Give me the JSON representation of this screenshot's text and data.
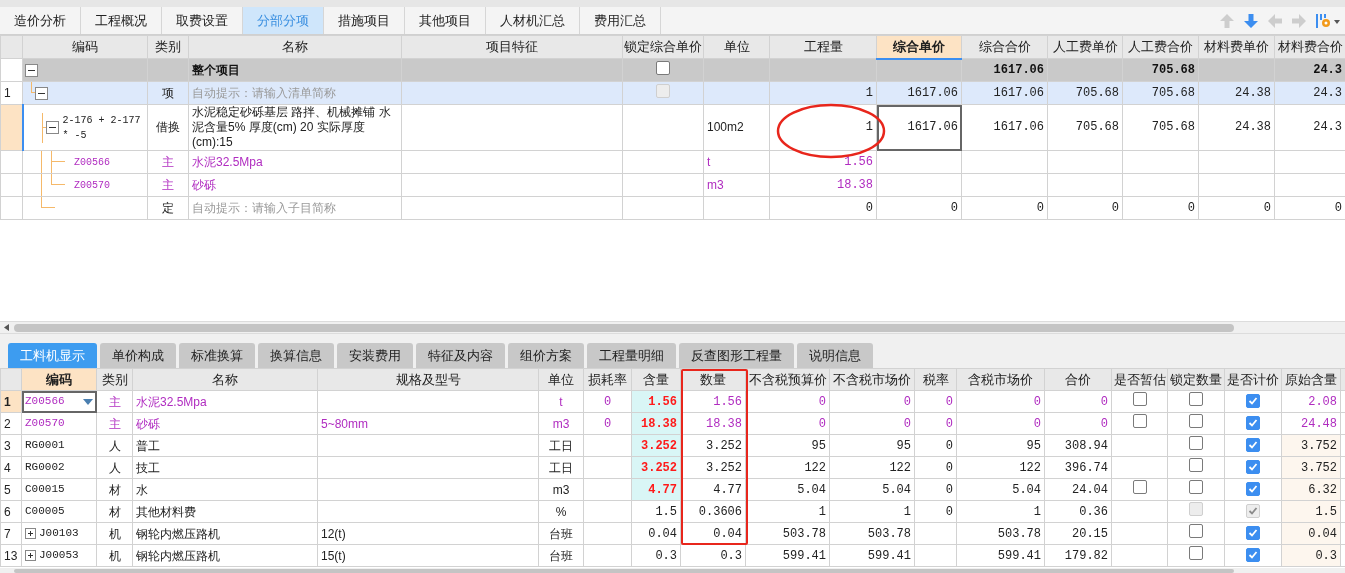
{
  "top_tabs": [
    {
      "label": "造价分析",
      "selected": false
    },
    {
      "label": "工程概况",
      "selected": false
    },
    {
      "label": "取费设置",
      "selected": false
    },
    {
      "label": "分部分项",
      "selected": true
    },
    {
      "label": "措施项目",
      "selected": false
    },
    {
      "label": "其他项目",
      "selected": false
    },
    {
      "label": "人材机汇总",
      "selected": false
    },
    {
      "label": "费用汇总",
      "selected": false
    }
  ],
  "toolbar": [
    {
      "kind": "up",
      "disabled": true
    },
    {
      "kind": "down",
      "disabled": false
    },
    {
      "kind": "left",
      "disabled": true
    },
    {
      "kind": "right",
      "disabled": true
    },
    {
      "kind": "settings",
      "disabled": false
    }
  ],
  "upper_table": {
    "columns": [
      {
        "label": "编码",
        "selected": false
      },
      {
        "label": "类别",
        "selected": false
      },
      {
        "label": "名称",
        "selected": false
      },
      {
        "label": "项目特征",
        "selected": false
      },
      {
        "label": "锁定综合单价",
        "selected": false
      },
      {
        "label": "单位",
        "selected": false
      },
      {
        "label": "工程量",
        "selected": false
      },
      {
        "label": "综合单价",
        "selected": true
      },
      {
        "label": "综合合价",
        "selected": false
      },
      {
        "label": "人工费单价",
        "selected": false
      },
      {
        "label": "人工费合价",
        "selected": false
      },
      {
        "label": "材料费单价",
        "selected": false
      },
      {
        "label": "材料费合价",
        "selected": false
      }
    ],
    "rows": [
      {
        "kind": "total",
        "selected": false,
        "expanded": true,
        "cells": [
          "",
          "",
          "整个项目",
          "",
          {
            "checked": false,
            "disabled": false
          },
          "",
          "",
          "",
          "1617.06",
          "",
          "705.68",
          "",
          "24.3"
        ],
        "children": [
          {
            "kind": "list",
            "selected": false,
            "number": "1",
            "expanded": true,
            "cells": [
              "",
              "项",
              {
                "placeholder": "自动提示：请输入清单简称"
              },
              "",
              {
                "checked": false,
                "disabled": true
              },
              "",
              "1",
              "1617.06",
              "1617.06",
              "705.68",
              "705.68",
              "24.38",
              "24.3"
            ],
            "children": [
              {
                "kind": "plain",
                "selected": true,
                "expanded": true,
                "cells": [
                  "2-176 + 2-177 * -5",
                  "借换",
                  "水泥稳定砂砾基层 路拌、机械摊铺 水泥含量5% 厚度(cm) 20  实际厚度(cm):15",
                  "",
                  "",
                  "100m2",
                  "1",
                  {
                    "text": "1617.06",
                    "focused": true
                  },
                  "1617.06",
                  "705.68",
                  "705.68",
                  "24.38",
                  "24.3"
                ],
                "children": [
                  {
                    "kind": "material",
                    "selected": false,
                    "cells": [
                      "Z00566",
                      "主",
                      "水泥32.5Mpa",
                      "",
                      "",
                      "t",
                      "1.56",
                      "",
                      "",
                      "",
                      "",
                      "",
                      ""
                    ]
                  },
                  {
                    "kind": "material",
                    "selected": false,
                    "cells": [
                      "Z00570",
                      "主",
                      "砂砾",
                      "",
                      "",
                      "m3",
                      "18.38",
                      "",
                      "",
                      "",
                      "",
                      "",
                      ""
                    ]
                  }
                ]
              },
              {
                "kind": "plain",
                "selected": false,
                "cells": [
                  "",
                  "定",
                  {
                    "placeholder": "自动提示：请输入子目简称"
                  },
                  "",
                  "",
                  "",
                  "0",
                  "0",
                  "0",
                  "0",
                  "0",
                  "0",
                  "0"
                ]
              }
            ]
          }
        ]
      }
    ]
  },
  "bottom_tabs": [
    {
      "label": "工料机显示",
      "selected": true
    },
    {
      "label": "单价构成",
      "selected": false
    },
    {
      "label": "标准换算",
      "selected": false
    },
    {
      "label": "换算信息",
      "selected": false
    },
    {
      "label": "安装费用",
      "selected": false
    },
    {
      "label": "特征及内容",
      "selected": false
    },
    {
      "label": "组价方案",
      "selected": false
    },
    {
      "label": "工程量明细",
      "selected": false
    },
    {
      "label": "反查图形工程量",
      "selected": false
    },
    {
      "label": "说明信息",
      "selected": false
    }
  ],
  "lower_table": {
    "columns": [
      {
        "label": "编码",
        "selected": true
      },
      {
        "label": "类别",
        "selected": false
      },
      {
        "label": "名称",
        "selected": false
      },
      {
        "label": "规格及型号",
        "selected": false
      },
      {
        "label": "单位",
        "selected": false
      },
      {
        "label": "损耗率",
        "selected": false
      },
      {
        "label": "含量",
        "selected": false
      },
      {
        "label": "数量",
        "selected": false
      },
      {
        "label": "不含税预算价",
        "selected": false
      },
      {
        "label": "不含税市场价",
        "selected": false
      },
      {
        "label": "税率",
        "selected": false
      },
      {
        "label": "含税市场价",
        "selected": false
      },
      {
        "label": "合价",
        "selected": false
      },
      {
        "label": "是否暂估",
        "selected": false
      },
      {
        "label": "锁定数量",
        "selected": false
      },
      {
        "label": "是否计价",
        "selected": false
      },
      {
        "label": "原始含量",
        "selected": false
      }
    ],
    "rows": [
      {
        "number": "1",
        "selected": true,
        "kind": "material",
        "modified": true,
        "cells": [
          {
            "text": "Z00566",
            "focused": true
          },
          "主",
          "水泥32.5Mpa",
          "",
          "t",
          "0",
          "1.56",
          "1.56",
          "0",
          "0",
          "0",
          "0",
          "0",
          {
            "checked": false,
            "disabled": false
          },
          {
            "checked": false,
            "disabled": false
          },
          {
            "checked": true,
            "disabled": false
          },
          "2.08"
        ]
      },
      {
        "number": "2",
        "selected": false,
        "kind": "material",
        "modified": true,
        "cells": [
          "Z00570",
          "主",
          "砂砾",
          "5~80mm",
          "m3",
          "0",
          "18.38",
          "18.38",
          "0",
          "0",
          "0",
          "0",
          "0",
          {
            "checked": false,
            "disabled": false
          },
          {
            "checked": false,
            "disabled": false
          },
          {
            "checked": true,
            "disabled": false
          },
          "24.48"
        ]
      },
      {
        "number": "3",
        "selected": false,
        "kind": "plain",
        "modified": true,
        "cells": [
          "RG0001",
          "人",
          "普工",
          "",
          "工日",
          "",
          "3.252",
          "3.252",
          "95",
          "95",
          "0",
          "95",
          "308.94",
          "",
          {
            "checked": false,
            "disabled": false
          },
          {
            "checked": true,
            "disabled": false
          },
          "3.752"
        ]
      },
      {
        "number": "4",
        "selected": false,
        "kind": "plain",
        "modified": true,
        "cells": [
          "RG0002",
          "人",
          "技工",
          "",
          "工日",
          "",
          "3.252",
          "3.252",
          "122",
          "122",
          "0",
          "122",
          "396.74",
          "",
          {
            "checked": false,
            "disabled": false
          },
          {
            "checked": true,
            "disabled": false
          },
          "3.752"
        ]
      },
      {
        "number": "5",
        "selected": false,
        "kind": "plain",
        "modified": true,
        "cells": [
          "C00015",
          "材",
          "水",
          "",
          "m3",
          "",
          "4.77",
          "4.77",
          "5.04",
          "5.04",
          "0",
          "5.04",
          "24.04",
          {
            "checked": false,
            "disabled": false
          },
          {
            "checked": false,
            "disabled": false
          },
          {
            "checked": true,
            "disabled": false
          },
          "6.32"
        ]
      },
      {
        "number": "6",
        "selected": false,
        "kind": "plain",
        "modified": false,
        "cells": [
          "C00005",
          "材",
          "其他材料费",
          "",
          "%",
          "",
          "1.5",
          "0.3606",
          "1",
          "1",
          "0",
          "1",
          "0.36",
          "",
          {
            "checked": false,
            "disabled": true
          },
          {
            "checked": true,
            "disabled": true
          },
          "1.5"
        ]
      },
      {
        "number": "7",
        "selected": false,
        "kind": "plain",
        "modified": false,
        "expanded": false,
        "cells": [
          "J00103",
          "机",
          "钢轮内燃压路机",
          "12(t)",
          "台班",
          "",
          "0.04",
          "0.04",
          "503.78",
          "503.78",
          "",
          "503.78",
          "20.15",
          "",
          {
            "checked": false,
            "disabled": false
          },
          {
            "checked": true,
            "disabled": false
          },
          "0.04"
        ]
      },
      {
        "number": "13",
        "selected": false,
        "kind": "plain",
        "modified": false,
        "expanded": false,
        "cells": [
          "J00053",
          "机",
          "钢轮内燃压路机",
          "15(t)",
          "台班",
          "",
          "0.3",
          "0.3",
          "599.41",
          "599.41",
          "",
          "599.41",
          "179.82",
          "",
          {
            "checked": false,
            "disabled": false
          },
          {
            "checked": true,
            "disabled": false
          },
          "0.3"
        ]
      }
    ]
  },
  "annotations": [
    {
      "kind": "ellipse"
    },
    {
      "kind": "rectangle"
    }
  ]
}
